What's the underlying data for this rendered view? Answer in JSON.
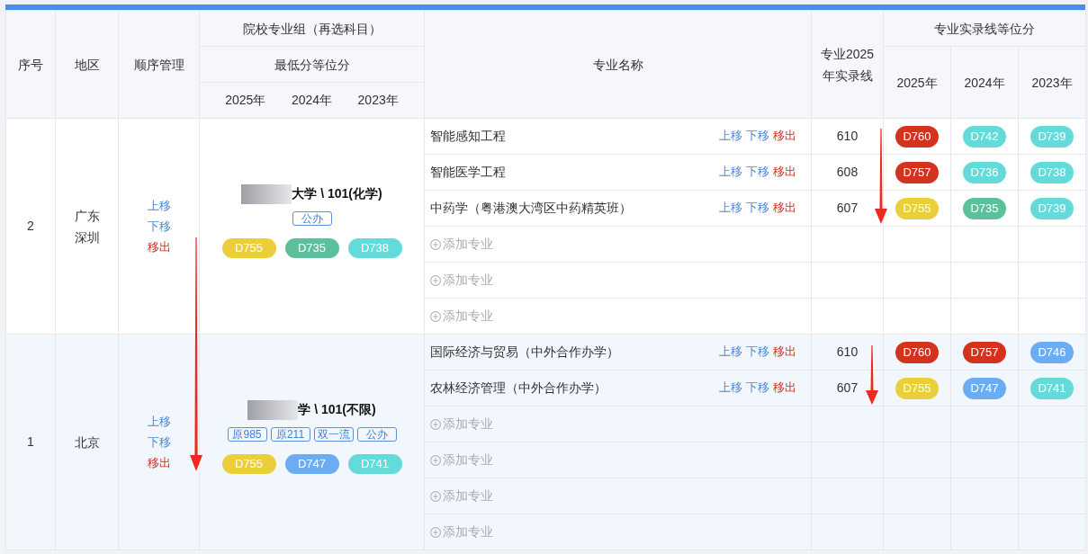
{
  "header": {
    "index": "序号",
    "region": "地区",
    "order": "顺序管理",
    "group": "院校专业组（再选科目）",
    "group_rank": "最低分等位分",
    "group_years": [
      "2025年",
      "2024年",
      "2023年"
    ],
    "major": "专业名称",
    "major_line": "专业2025年实录线",
    "major_rank": "专业实录线等位分",
    "major_rank_years": [
      "2025年",
      "2024年",
      "2023年"
    ]
  },
  "groups": [
    {
      "index": "2",
      "region": "广东深圳",
      "highlighted": false,
      "actions": [
        {
          "kind": "move",
          "label": "上移"
        },
        {
          "kind": "move",
          "label": "下移"
        },
        {
          "kind": "remove",
          "label": "移出"
        }
      ],
      "redacted": true,
      "school": "大学 \\ 101(化学)",
      "tags": [
        "公办"
      ],
      "ranks": [
        {
          "text": "D755",
          "color": "#eacf3a"
        },
        {
          "text": "D735",
          "color": "#5cc09a"
        },
        {
          "text": "D738",
          "color": "#65dadb"
        }
      ],
      "majors": [
        {
          "kind": "major",
          "name": "智能感知工程",
          "actions": [
            {
              "kind": "move",
              "label": "上移"
            },
            {
              "kind": "move",
              "label": "下移"
            },
            {
              "kind": "remove",
              "label": "移出"
            }
          ],
          "line": "610",
          "ranks": [
            {
              "text": "D760",
              "color": "#d4311e"
            },
            {
              "text": "D742",
              "color": "#65dadb"
            },
            {
              "text": "D739",
              "color": "#65dadb"
            }
          ]
        },
        {
          "kind": "major",
          "name": "智能医学工程",
          "actions": [
            {
              "kind": "move",
              "label": "上移"
            },
            {
              "kind": "move",
              "label": "下移"
            },
            {
              "kind": "remove",
              "label": "移出"
            }
          ],
          "line": "608",
          "ranks": [
            {
              "text": "D757",
              "color": "#d4311e"
            },
            {
              "text": "D736",
              "color": "#65dadb"
            },
            {
              "text": "D738",
              "color": "#65dadb"
            }
          ]
        },
        {
          "kind": "major",
          "name": "中药学（粤港澳大湾区中药精英班）",
          "actions": [
            {
              "kind": "move",
              "label": "上移"
            },
            {
              "kind": "move",
              "label": "下移"
            },
            {
              "kind": "remove",
              "label": "移出"
            }
          ],
          "line": "607",
          "ranks": [
            {
              "text": "D755",
              "color": "#eacf3a"
            },
            {
              "text": "D735",
              "color": "#5cc09a"
            },
            {
              "text": "D739",
              "color": "#65dadb"
            }
          ]
        },
        {
          "kind": "add",
          "label": "添加专业"
        },
        {
          "kind": "add",
          "label": "添加专业"
        },
        {
          "kind": "add",
          "label": "添加专业"
        }
      ]
    },
    {
      "index": "1",
      "region": "北京",
      "highlighted": true,
      "actions": [
        {
          "kind": "move",
          "label": "上移"
        },
        {
          "kind": "move",
          "label": "下移"
        },
        {
          "kind": "remove",
          "label": "移出"
        }
      ],
      "redacted": true,
      "school": "学 \\ 101(不限)",
      "tags": [
        "原985",
        "原211",
        "双一流",
        "公办"
      ],
      "ranks": [
        {
          "text": "D755",
          "color": "#eacf3a"
        },
        {
          "text": "D747",
          "color": "#6cacf3"
        },
        {
          "text": "D741",
          "color": "#65dadb"
        }
      ],
      "majors": [
        {
          "kind": "major",
          "name": "国际经济与贸易（中外合作办学）",
          "actions": [
            {
              "kind": "move",
              "label": "上移"
            },
            {
              "kind": "move",
              "label": "下移"
            },
            {
              "kind": "remove",
              "label": "移出"
            }
          ],
          "line": "610",
          "ranks": [
            {
              "text": "D760",
              "color": "#d4311e"
            },
            {
              "text": "D757",
              "color": "#d4311e"
            },
            {
              "text": "D746",
              "color": "#6cacf3"
            }
          ]
        },
        {
          "kind": "major",
          "name": "农林经济管理（中外合作办学）",
          "actions": [
            {
              "kind": "move",
              "label": "上移"
            },
            {
              "kind": "move",
              "label": "下移"
            },
            {
              "kind": "remove",
              "label": "移出"
            }
          ],
          "line": "607",
          "ranks": [
            {
              "text": "D755",
              "color": "#eacf3a"
            },
            {
              "text": "D747",
              "color": "#6cacf3"
            },
            {
              "text": "D741",
              "color": "#65dadb"
            }
          ]
        },
        {
          "kind": "add",
          "label": "添加专业"
        },
        {
          "kind": "add",
          "label": "添加专业"
        },
        {
          "kind": "add",
          "label": "添加专业"
        },
        {
          "kind": "add",
          "label": "添加专业"
        }
      ]
    }
  ]
}
